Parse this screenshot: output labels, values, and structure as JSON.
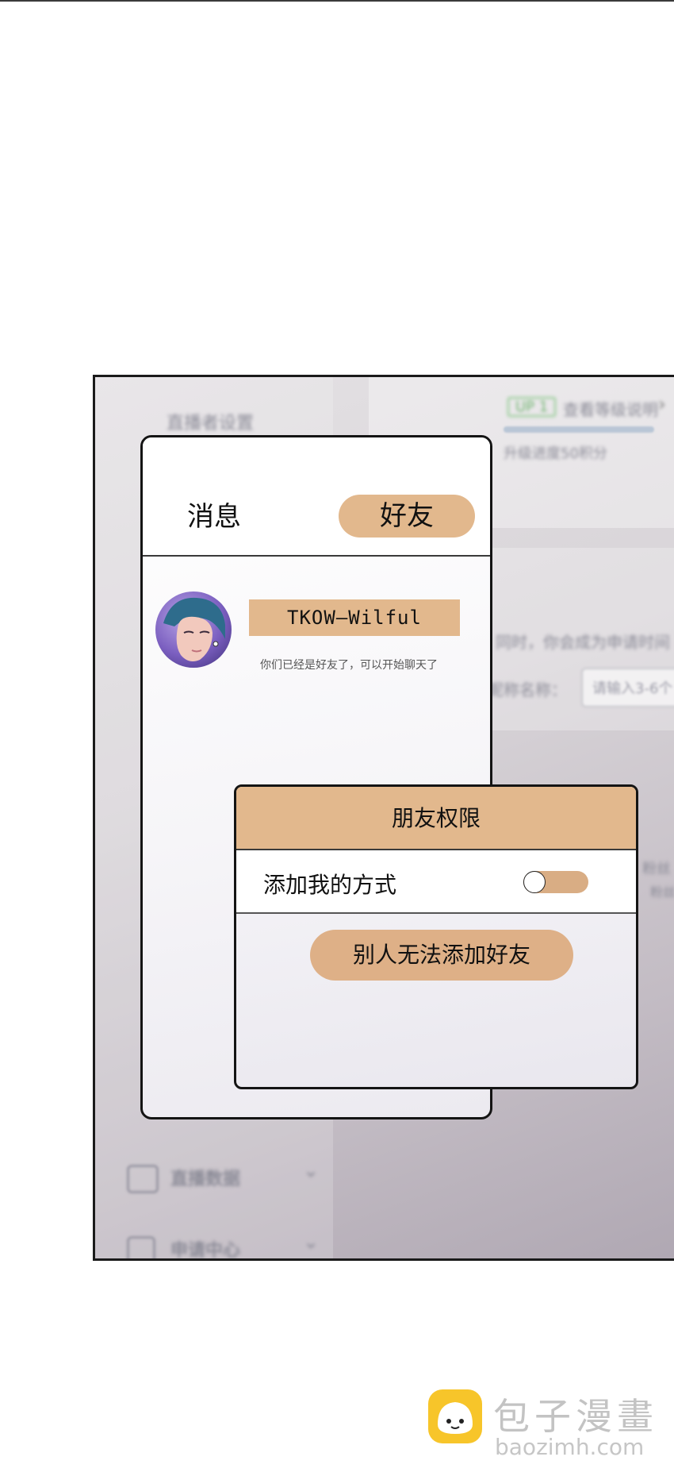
{
  "background_app": {
    "live_settings_label": "直播者设置",
    "level_badge": "UP 1",
    "level_link": "查看等级说明",
    "upgrade_progress_text": "升级进度50积分",
    "hint_text": "同时，你会成为申请时间",
    "name_label": "昵称名称：",
    "name_placeholder": "请输入3-6个",
    "right_text_1": "粉丝",
    "right_text_2": "粉丝",
    "menu": [
      {
        "label": "直播数据",
        "icon": "chart-icon"
      },
      {
        "label": "申请中心",
        "icon": "apply-icon"
      }
    ]
  },
  "card": {
    "tab_messages": "消息",
    "tab_friends": "好友",
    "friend": {
      "name": "TKOW—Wilful",
      "note": "你们已经是好友了，可以开始聊天了"
    }
  },
  "dialog": {
    "title": "朋友权限",
    "add_me_label": "添加我的方式",
    "toggle_on": false,
    "button_label": "别人无法添加好友"
  },
  "watermark": {
    "name": "包子漫畫",
    "url": "baozimh.com"
  },
  "colors": {
    "accent": "#e2b88d",
    "panel_border": "#141414"
  }
}
